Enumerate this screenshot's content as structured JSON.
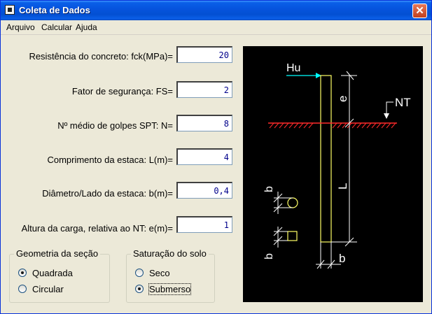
{
  "window": {
    "title": "Coleta de Dados",
    "close_glyph": "✕"
  },
  "menu": {
    "items": [
      "Arquivo",
      "Calcular",
      "Ajuda"
    ]
  },
  "form": {
    "fields": [
      {
        "label": "Resistência do concreto: fck(MPa)=",
        "value": "20"
      },
      {
        "label": "Fator de segurança: FS=",
        "value": "2"
      },
      {
        "label": "Nº médio de golpes SPT: N=",
        "value": "8"
      },
      {
        "label": "Comprimento da estaca: L(m)=",
        "value": "4"
      },
      {
        "label": "Diâmetro/Lado da estaca: b(m)=",
        "value": "0,4"
      },
      {
        "label": "Altura da carga, relativa ao NT: e(m)=",
        "value": "1"
      }
    ]
  },
  "geometria": {
    "title": "Geometria da seção",
    "options": [
      {
        "label": "Quadrada",
        "checked": true
      },
      {
        "label": "Circular",
        "checked": false
      }
    ]
  },
  "saturacao": {
    "title": "Saturação do solo",
    "options": [
      {
        "label": "Seco",
        "checked": false
      },
      {
        "label": "Submerso",
        "checked": true
      }
    ]
  },
  "diagram": {
    "labels": {
      "hu": "Hu",
      "nt": "NT",
      "e": "e",
      "l": "L",
      "b_bottom": "b",
      "b_circle": "b",
      "b_square": "b"
    },
    "colors": {
      "background": "#000000",
      "pile": "#ffff66",
      "dimension": "#ffffff",
      "arrow": "#00ffff",
      "ground": "#ff2a2a"
    }
  }
}
